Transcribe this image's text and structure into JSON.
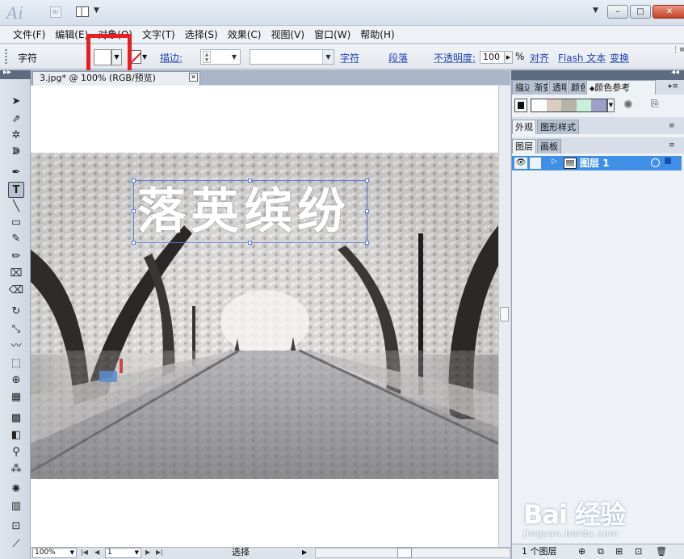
{
  "app": {
    "logo": "Ai",
    "br_label": "Br"
  },
  "window": {
    "minimize": "–",
    "restore": "□",
    "close": "✕",
    "title_dropdown": "▼"
  },
  "menu": [
    "文件(F)",
    "编辑(E)",
    "对象(O)",
    "文字(T)",
    "选择(S)",
    "效果(C)",
    "视图(V)",
    "窗口(W)",
    "帮助(H)"
  ],
  "control_bar": {
    "mode_label": "字符",
    "stroke_label": "描边:",
    "char_link": "字符",
    "para_link": "段落",
    "opacity_label": "不透明度:",
    "opacity_value": "100",
    "percent": "%",
    "align_link": "对齐",
    "flash_text_link": "Flash 文本",
    "transform_link": "变换"
  },
  "document": {
    "tab_title": "3.jpg* @ 100% (RGB/预览)",
    "text_on_canvas": "落英缤纷"
  },
  "status": {
    "zoom": "100%",
    "page": "1",
    "tool_text": "选择"
  },
  "right_panel": {
    "top_tabs": [
      "描边",
      "渐变",
      "透明",
      "颜色",
      "颜色参考"
    ],
    "mid_tabs": [
      "外观",
      "图形样式"
    ],
    "layer_tabs": [
      "图层",
      "画板"
    ],
    "layer_name": "图层 1",
    "layer_count": "1 个图层"
  },
  "watermark": {
    "logo": "Bai 经验",
    "url": "jingyan.baidu.com"
  },
  "colors": {
    "highlight": "#e81e25",
    "selection": "#3f8fe6",
    "link": "#1c3fb3"
  }
}
